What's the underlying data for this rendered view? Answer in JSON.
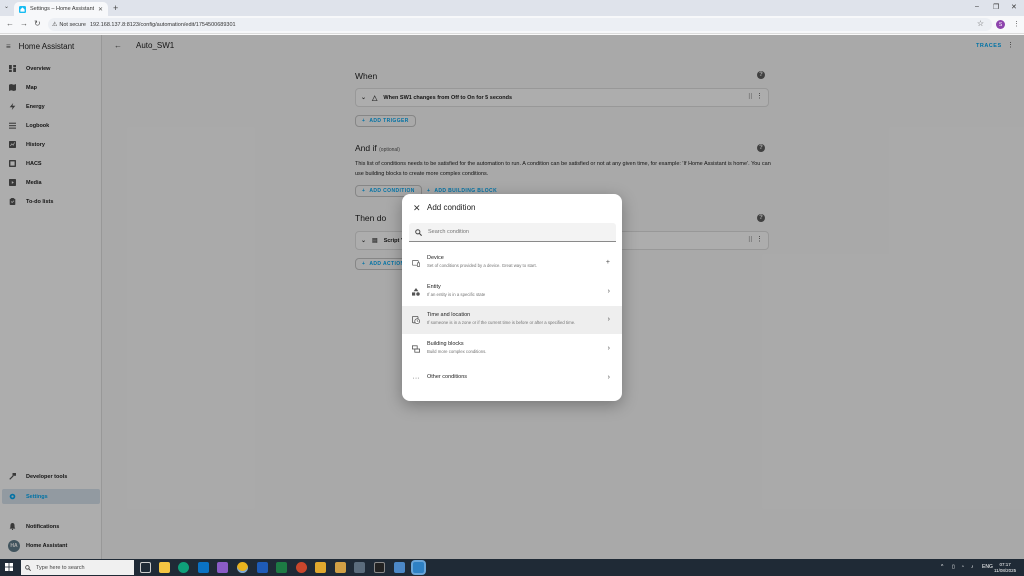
{
  "browser": {
    "tab_title": "Settings – Home Assistant",
    "not_secure": "Not secure",
    "url": "192.168.137.8:8123/config/automation/edit/1754500689301",
    "profile_initial": "S"
  },
  "sidebar": {
    "title": "Home Assistant",
    "items": [
      {
        "label": "Overview",
        "icon": "view-dashboard-icon"
      },
      {
        "label": "Map",
        "icon": "map-icon"
      },
      {
        "label": "Energy",
        "icon": "lightning-icon"
      },
      {
        "label": "Logbook",
        "icon": "logbook-icon"
      },
      {
        "label": "History",
        "icon": "chart-icon"
      },
      {
        "label": "HACS",
        "icon": "hacs-icon"
      },
      {
        "label": "Media",
        "icon": "media-icon"
      },
      {
        "label": "To-do lists",
        "icon": "clipboard-icon"
      }
    ],
    "bottom": {
      "developer_tools": "Developer tools",
      "settings": "Settings",
      "notifications": "Notifications",
      "user": "Home Assistant",
      "user_initials": "HA"
    }
  },
  "header": {
    "title": "Auto_SW1",
    "traces": "TRACES"
  },
  "editor": {
    "when_title": "When",
    "trigger_text": "When SW1 changes from Off to On for 5 seconds",
    "add_trigger": "ADD TRIGGER",
    "and_if_title": "And if",
    "and_if_optional": "(optional)",
    "and_if_desc": "This list of conditions needs to be satisfied for the automation to run. A condition can be satisfied or not at any given time, for example: 'If Home Assistant is home'. You can use building blocks to create more complex conditions.",
    "add_condition": "ADD CONDITION",
    "add_building_block": "ADD BUILDING BLOCK",
    "then_title": "Then do",
    "action_text": "Script '",
    "add_action": "ADD ACTION"
  },
  "dialog": {
    "title": "Add condition",
    "search_placeholder": "Search condition",
    "items": [
      {
        "title": "Device",
        "subtitle": "Set of conditions provided by a device. Great way to start.",
        "icon": "device-icon",
        "end": "plus-icon"
      },
      {
        "title": "Entity",
        "subtitle": "If an entity is in a specific state",
        "icon": "entity-icon",
        "end": "chevron-right-icon"
      },
      {
        "title": "Time and location",
        "subtitle": "If someone is in a zone or if the current time is before or after a specified time.",
        "icon": "time-location-icon",
        "end": "chevron-right-icon"
      },
      {
        "title": "Building blocks",
        "subtitle": "Build more complex conditions.",
        "icon": "building-blocks-icon",
        "end": "chevron-right-icon"
      },
      {
        "title": "Other conditions",
        "subtitle": "",
        "icon": "dots-icon",
        "end": "chevron-right-icon"
      }
    ]
  },
  "taskbar": {
    "search_placeholder": "Type here to search",
    "lang": "ENG",
    "time": "07:17",
    "date": "11/08/2025"
  },
  "colors": {
    "accent": "#03a9f4",
    "sidebar_active_bg": "#d7e3ee",
    "taskbar_bg": "#1f2a36"
  }
}
